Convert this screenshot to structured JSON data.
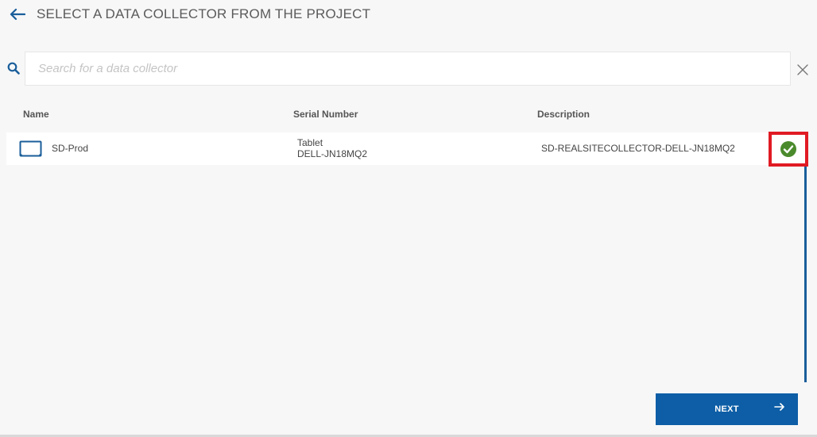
{
  "header": {
    "title": "SELECT A DATA COLLECTOR FROM THE PROJECT",
    "back_icon": "arrow-left-icon"
  },
  "search": {
    "placeholder": "Search for a data collector",
    "value": "",
    "search_icon": "search-icon",
    "clear_icon": "close-icon"
  },
  "table": {
    "columns": [
      "Name",
      "Serial Number",
      "Description"
    ],
    "rows": [
      {
        "icon": "tablet-icon",
        "name": "SD-Prod",
        "serial_line1": "Tablet",
        "serial_line2": "DELL-JN18MQ2",
        "description": "SD-REALSITECOLLECTOR-DELL-JN18MQ2",
        "selected": true,
        "status_icon": "check-circle-icon"
      }
    ]
  },
  "footer": {
    "next_label": "NEXT",
    "next_icon": "arrow-right-icon"
  },
  "colors": {
    "accent": "#0d5ea6",
    "success": "#4a8a2c",
    "highlight": "#e01b24"
  }
}
